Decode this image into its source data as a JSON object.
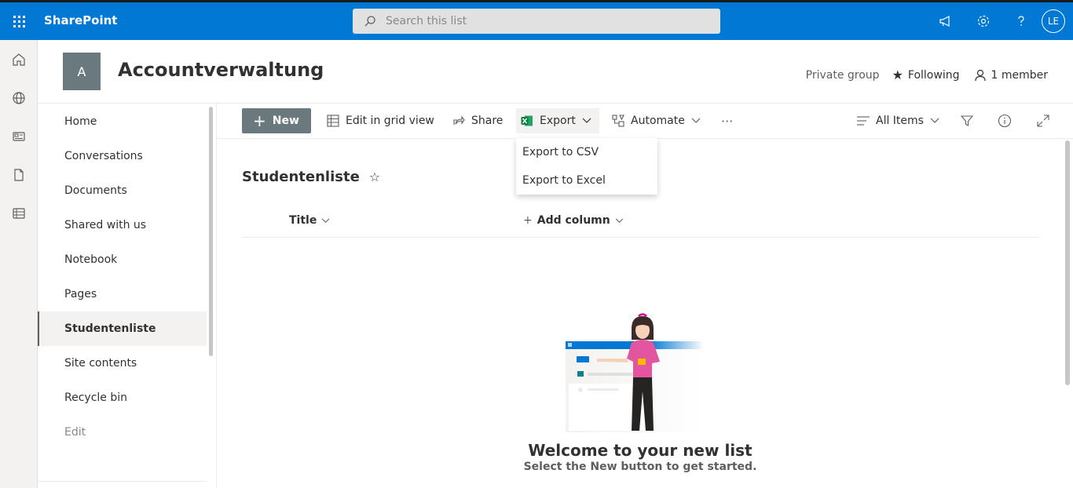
{
  "topbar": {
    "brand": "SharePoint",
    "search_placeholder": "Search this list",
    "avatar_initials": "LE"
  },
  "site": {
    "logo_letter": "A",
    "title": "Accountverwaltung",
    "privacy": "Private group",
    "following": "Following",
    "members": "1 member"
  },
  "nav": {
    "items": [
      {
        "label": "Home"
      },
      {
        "label": "Conversations"
      },
      {
        "label": "Documents"
      },
      {
        "label": "Shared with us"
      },
      {
        "label": "Notebook"
      },
      {
        "label": "Pages"
      },
      {
        "label": "Studentenliste"
      },
      {
        "label": "Site contents"
      },
      {
        "label": "Recycle bin"
      },
      {
        "label": "Edit"
      }
    ]
  },
  "commandbar": {
    "new": "New",
    "edit_grid": "Edit in grid view",
    "share": "Share",
    "export": "Export",
    "automate": "Automate",
    "more": "···",
    "view": "All Items"
  },
  "export_menu": {
    "items": [
      "Export to CSV",
      "Export to Excel"
    ]
  },
  "list": {
    "title": "Studentenliste",
    "columns": {
      "title": "Title",
      "add": "Add column"
    },
    "welcome": "Welcome to your new list",
    "welcome_sub": "Select the New button to get started."
  },
  "colors": {
    "brand_blue": "#0078d4",
    "excel_green": "#107c41",
    "site_logo_bg": "#69797e"
  }
}
